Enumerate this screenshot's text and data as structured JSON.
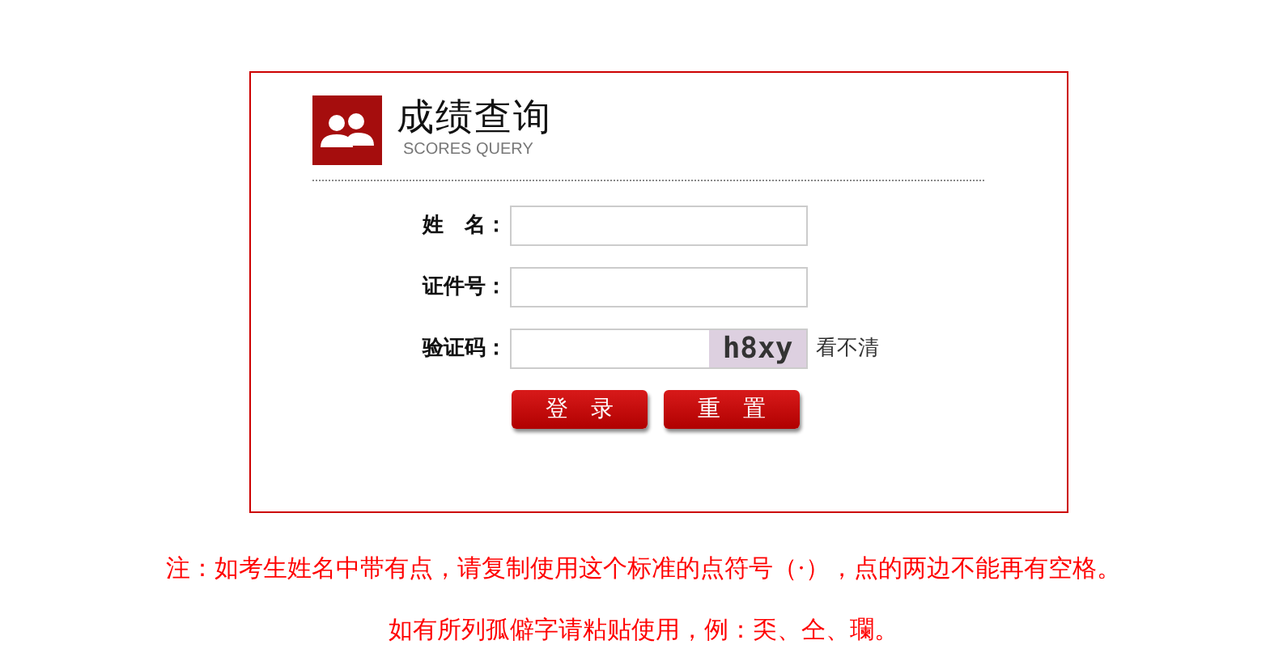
{
  "header": {
    "title": "成绩查询",
    "subtitle": "SCORES QUERY"
  },
  "fields": [
    {
      "label": "姓　名：",
      "kind": "text"
    },
    {
      "label": "证件号：",
      "kind": "text"
    },
    {
      "label": "验证码：",
      "kind": "captcha",
      "captcha": "h8xy",
      "refresh": "看不清"
    }
  ],
  "buttons": [
    "登　录",
    "重　置"
  ],
  "notes": [
    "注：如考生姓名中带有点，请复制使用这个标准的点符号（·），点的两边不能再有空格。",
    "如有所列孤僻字请粘贴使用，例：奀、仝、瓓。"
  ]
}
